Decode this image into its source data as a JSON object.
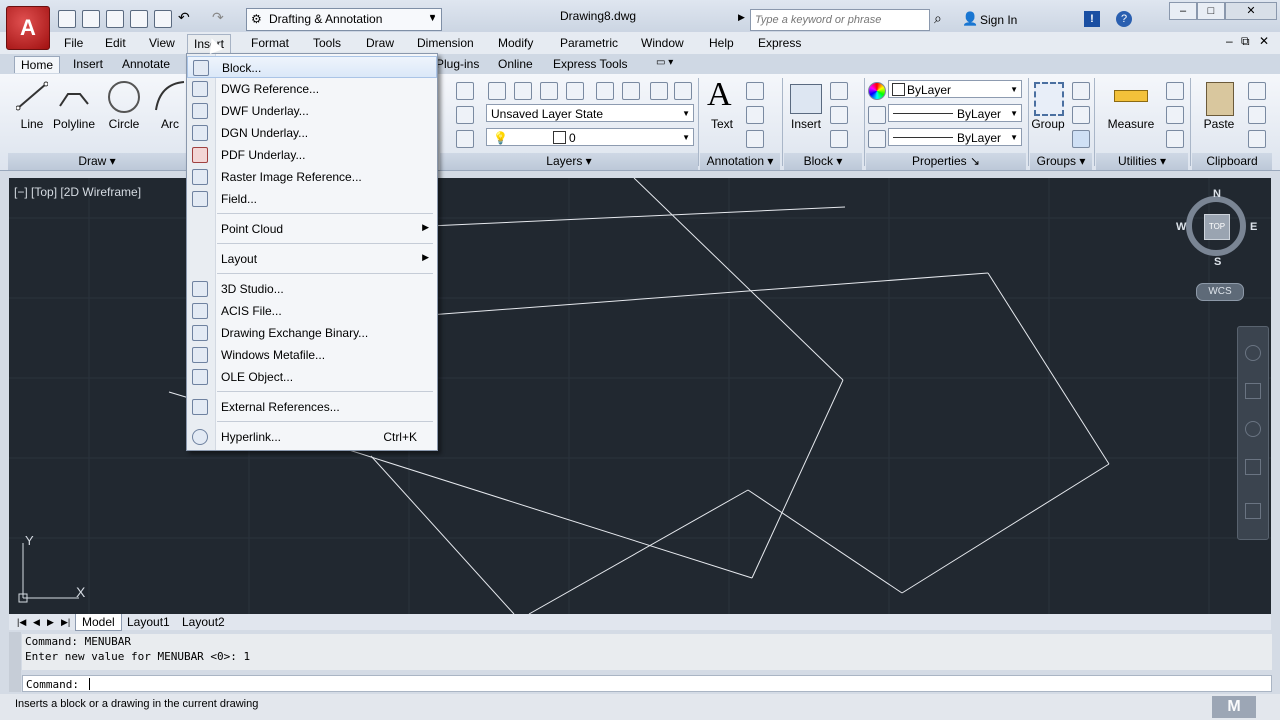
{
  "app": {
    "workspace": "Drafting & Annotation",
    "document_title": "Drawing8.dwg",
    "search_placeholder": "Type a keyword or phrase",
    "sign_in": "Sign In"
  },
  "menubar": [
    "File",
    "Edit",
    "View",
    "Insert",
    "Format",
    "Tools",
    "Draw",
    "Dimension",
    "Modify",
    "Parametric",
    "Window",
    "Help",
    "Express"
  ],
  "ribbon_tabs": [
    "Home",
    "Insert",
    "Annotate",
    "Plug-ins",
    "Online",
    "Express Tools"
  ],
  "ribbon": {
    "draw_tools": [
      "Line",
      "Polyline",
      "Circle",
      "Arc"
    ],
    "draw_panel": "Draw",
    "layer_state": "Unsaved Layer State",
    "layer_current": "0",
    "layers_panel": "Layers",
    "text_label": "Text",
    "annotation_panel": "Annotation",
    "insert_label": "Insert",
    "block_panel": "Block",
    "prop_color": "ByLayer",
    "prop_linetype": "ByLayer",
    "prop_lineweight": "ByLayer",
    "properties_panel": "Properties",
    "group_label": "Group",
    "groups_panel": "Groups",
    "measure_label": "Measure",
    "utilities_panel": "Utilities",
    "paste_label": "Paste",
    "clipboard_panel": "Clipboard"
  },
  "viewport": {
    "label": "[−] [Top] [2D Wireframe]",
    "compass": {
      "n": "N",
      "s": "S",
      "e": "E",
      "w": "W",
      "top": "TOP"
    },
    "wcs": "WCS",
    "ucs_y": "Y",
    "ucs_x": "X"
  },
  "layout_tabs": [
    "Model",
    "Layout1",
    "Layout2"
  ],
  "command_history": [
    "Command: MENUBAR",
    "Enter new value for MENUBAR <0>: 1"
  ],
  "command_prompt": "Command:",
  "status_text": "Inserts a block or a drawing in the current drawing",
  "insert_menu": [
    {
      "label": "Block...",
      "icon": "block-icon"
    },
    {
      "label": "DWG Reference...",
      "icon": "dwg-icon"
    },
    {
      "label": "DWF Underlay...",
      "icon": "dwf-icon"
    },
    {
      "label": "DGN Underlay...",
      "icon": "dgn-icon"
    },
    {
      "label": "PDF Underlay...",
      "icon": "pdf-icon"
    },
    {
      "label": "Raster Image Reference...",
      "icon": "image-icon"
    },
    {
      "label": "Field...",
      "icon": "field-icon"
    },
    {
      "label": "Point Cloud",
      "submenu": true
    },
    {
      "label": "Layout",
      "submenu": true
    },
    {
      "label": "3D Studio...",
      "icon": "3ds-icon"
    },
    {
      "label": "ACIS File...",
      "icon": "acis-icon"
    },
    {
      "label": "Drawing Exchange Binary...",
      "icon": "dxb-icon"
    },
    {
      "label": "Windows Metafile...",
      "icon": "wmf-icon"
    },
    {
      "label": "OLE Object...",
      "icon": "ole-icon"
    },
    {
      "label": "External References...",
      "icon": "xref-icon"
    },
    {
      "label": "Hyperlink...",
      "icon": "hyperlink-icon",
      "shortcut": "Ctrl+K"
    }
  ]
}
